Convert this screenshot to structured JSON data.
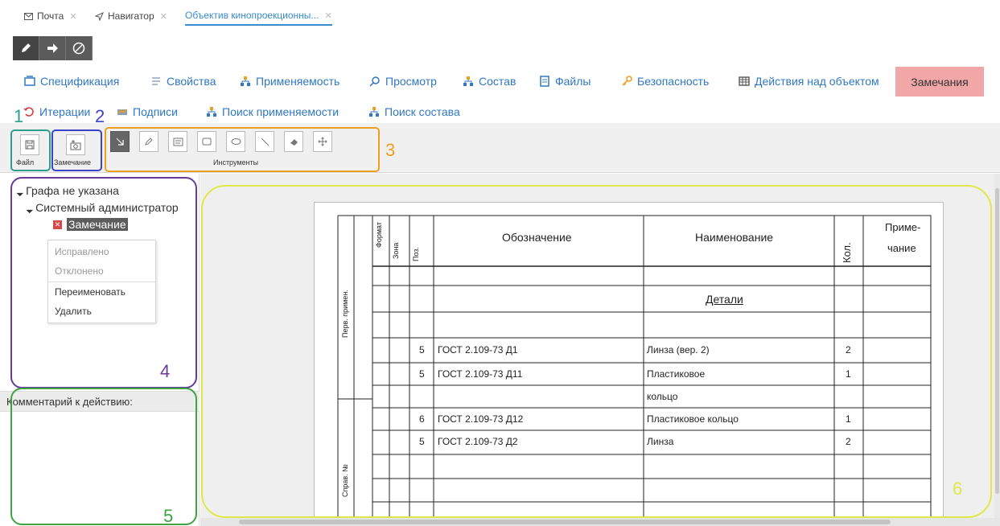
{
  "tabs": [
    {
      "label": "Почта",
      "icon": "mail-icon"
    },
    {
      "label": "Навигатор",
      "icon": "navigator-arrow-icon"
    },
    {
      "label": "Объектив кинопроекционны...",
      "icon": ""
    }
  ],
  "nav_row1": {
    "spec": "Спецификация",
    "props": "Свойства",
    "usage": "Применяемость",
    "view": "Просмотр",
    "composition": "Состав",
    "files": "Файлы",
    "security": "Безопасность",
    "actions": "Действия над объектом",
    "remarks": "Замечания"
  },
  "nav_row2": {
    "iterations": "Итерации",
    "signatures": "Подписи",
    "search_usage": "Поиск применяемости",
    "search_composition": "Поиск состава"
  },
  "toolbar": {
    "file_label": "Файл",
    "remark_label": "Замечание",
    "tools_label": "Инструменты"
  },
  "annotations": {
    "n1": "1",
    "n2": "2",
    "n3": "3",
    "n4": "4",
    "n5": "5",
    "n6": "6"
  },
  "tree": {
    "root": "Графа не указана",
    "child": "Системный администратор",
    "leaf": "Замечание"
  },
  "context_menu": {
    "fixed": "Исправлено",
    "rejected": "Отклонено",
    "rename": "Переименовать",
    "delete": "Удалить"
  },
  "comment_label": "Комментарий к действию:",
  "spec_table": {
    "headers": {
      "format": "Формат",
      "zone": "Зона",
      "pos": "Поз.",
      "designation": "Обозначение",
      "name": "Наименование",
      "qty": "Кол.",
      "note1": "Приме-",
      "note2": "чание"
    },
    "side1": "Перв. примен.",
    "side2": "Справ. №",
    "section": "Детали",
    "rows": [
      {
        "pos": "5",
        "designation": "ГОСТ 2.109-73 Д1",
        "name": "Линза (вер. 2)",
        "qty": "2"
      },
      {
        "pos": "5",
        "designation": "ГОСТ 2.109-73 Д11",
        "name": "Пластиковое",
        "qty": "1"
      },
      {
        "pos": "",
        "designation": "",
        "name": "кольцо",
        "qty": ""
      },
      {
        "pos": "6",
        "designation": "ГОСТ 2.109-73 Д12",
        "name": "Пластиковое кольцо",
        "qty": "1"
      },
      {
        "pos": "5",
        "designation": "ГОСТ 2.109-73 Д2",
        "name": "Линза",
        "qty": "2"
      }
    ]
  },
  "colors": {
    "link": "#2f78c2",
    "remarks_bg": "#f1a7a7",
    "group1": "#2e9e8a",
    "group2": "#3b43c9",
    "group3": "#f0a020",
    "group4": "#6a3a9a",
    "group5": "#3fa340",
    "group6": "#dfe84a",
    "active_tab": "#3a8bd0"
  }
}
